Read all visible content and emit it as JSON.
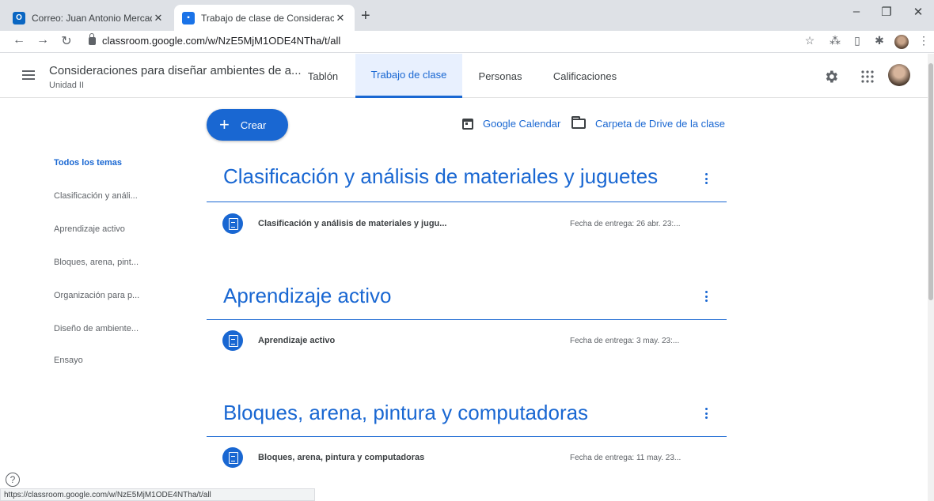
{
  "browser": {
    "tabs": [
      {
        "title": "Correo: Juan Antonio Mercado P",
        "favicon": "outlook-icon",
        "favicon_color": "#0a66c2"
      },
      {
        "title": "Trabajo de clase de Consideracio",
        "favicon": "classroom-icon",
        "favicon_color": "#1a73e8"
      }
    ],
    "url": "classroom.google.com/w/NzE5MjM1ODE4NTha/t/all",
    "status_url": "https://classroom.google.com/w/NzE5MjM1ODE4NTha/t/all"
  },
  "header": {
    "class_title": "Consideraciones para diseñar ambientes de a...",
    "class_subtitle": "Unidad II",
    "tabs": [
      {
        "label": "Tablón"
      },
      {
        "label": "Trabajo de clase",
        "active": true
      },
      {
        "label": "Personas"
      },
      {
        "label": "Calificaciones"
      }
    ]
  },
  "toolbar": {
    "create_label": "Crear",
    "calendar_label": "Google Calendar",
    "drive_label": "Carpeta de Drive de la clase"
  },
  "topics": [
    {
      "label": "Todos los temas",
      "active": true
    },
    {
      "label": "Clasificación y análi..."
    },
    {
      "label": "Aprendizaje activo"
    },
    {
      "label": "Bloques, arena, pint..."
    },
    {
      "label": "Organización para p..."
    },
    {
      "label": "Diseño de ambiente..."
    },
    {
      "label": "Ensayo"
    }
  ],
  "sections": [
    {
      "title": "Clasificación y análisis de materiales y juguetes",
      "item": {
        "title": "Clasificación y análisis de materiales y jugu...",
        "due": "Fecha de entrega: 26 abr. 23:..."
      }
    },
    {
      "title": "Aprendizaje activo",
      "item": {
        "title": "Aprendizaje activo",
        "due": "Fecha de entrega: 3 may. 23:..."
      }
    },
    {
      "title": "Bloques, arena, pintura y computadoras",
      "item": {
        "title": "Bloques, arena, pintura y computadoras",
        "due": "Fecha de entrega: 11 may. 23..."
      }
    }
  ],
  "colors": {
    "accent": "#1967d2",
    "active_tab_bg": "#e8f0fe"
  }
}
